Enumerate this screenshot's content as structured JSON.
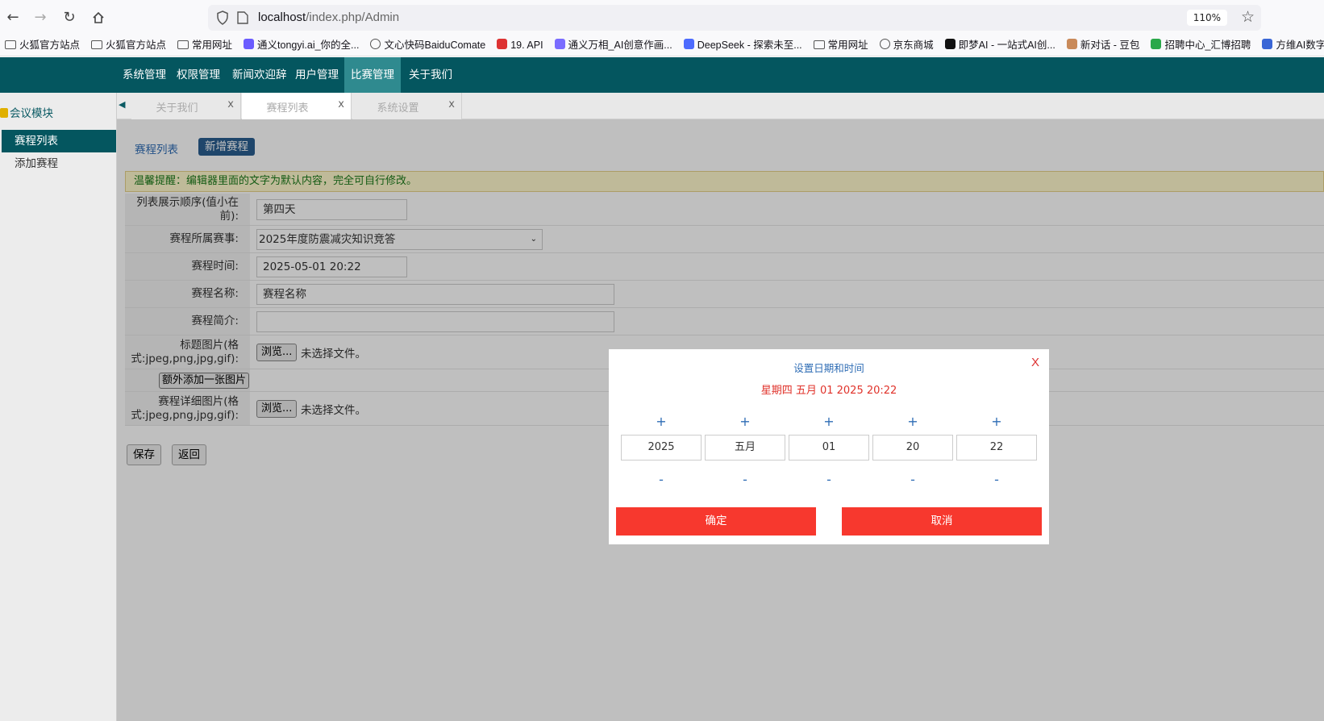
{
  "browser": {
    "url_host": "localhost",
    "url_path": "/index.php/Admin",
    "zoom": "110%",
    "bookmarks": [
      {
        "label": "火狐官方站点",
        "icon": "folder-icon"
      },
      {
        "label": "火狐官方站点",
        "icon": "folder-icon"
      },
      {
        "label": "常用网址",
        "icon": "folder-icon"
      },
      {
        "label": "通义tongyi.ai_你的全...",
        "icon": "tongyi-icon"
      },
      {
        "label": "文心快码BaiduComate",
        "icon": "globe-icon"
      },
      {
        "label": "19. API",
        "icon": "book-icon"
      },
      {
        "label": "通义万相_AI创意作画...",
        "icon": "wanxiang-icon"
      },
      {
        "label": "DeepSeek - 探索未至...",
        "icon": "deepseek-icon"
      },
      {
        "label": "常用网址",
        "icon": "folder-icon"
      },
      {
        "label": "京东商城",
        "icon": "globe-icon"
      },
      {
        "label": "即梦AI - 一站式AI创...",
        "icon": "jimeng-icon"
      },
      {
        "label": "新对话 - 豆包",
        "icon": "doubao-icon"
      },
      {
        "label": "招聘中心_汇博招聘",
        "icon": "huibo-icon"
      },
      {
        "label": "方维AI数字人",
        "icon": "fangwei-icon"
      }
    ]
  },
  "appnav": {
    "items": [
      "系统管理",
      "权限管理",
      "新闻欢迎辞",
      "用户管理",
      "比赛管理",
      "关于我们"
    ],
    "active_index": 4
  },
  "sidebar": {
    "module_title": "会议模块",
    "items": [
      "赛程列表",
      "添加赛程"
    ],
    "active_index": 0
  },
  "tabs": [
    {
      "label": "关于我们",
      "close": "x"
    },
    {
      "label": "赛程列表",
      "close": "x"
    },
    {
      "label": "系统设置",
      "close": "x"
    }
  ],
  "content": {
    "subtab_link": "赛程列表",
    "subtab_active": "新增赛程",
    "notice": "温馨提醒：编辑器里面的文字为默认内容，完全可自行修改。",
    "form": {
      "order_label": "列表展示顺序(值小在前):",
      "order_value": "第四天",
      "event_label": "赛程所属赛事:",
      "event_value": "2025年度防震减灾知识竞答",
      "time_label": "赛程时间:",
      "time_value": "2025-05-01 20:22",
      "name_label": "赛程名称:",
      "name_value": "赛程名称",
      "intro_label": "赛程简介:",
      "intro_value": "",
      "title_img_label": "标题图片(格式:jpeg,png,jpg,gif):",
      "browse_label": "浏览...",
      "no_file_text": "未选择文件。",
      "extra_img_button": "额外添加一张图片",
      "detail_img_label": "赛程详细图片(格式:jpeg,png,jpg,gif):",
      "save_label": "保存",
      "back_label": "返回"
    }
  },
  "datepicker": {
    "title": "设置日期和时间",
    "close": "X",
    "current": "星期四 五月 01 2025 20:22",
    "plus": "+",
    "minus": "-",
    "fields": [
      {
        "name": "year",
        "value": "2025"
      },
      {
        "name": "month",
        "value": "五月"
      },
      {
        "name": "day",
        "value": "01"
      },
      {
        "name": "hour",
        "value": "20"
      },
      {
        "name": "minute",
        "value": "22"
      }
    ],
    "confirm_label": "确定",
    "cancel_label": "取消"
  },
  "colors": {
    "nav_bg": "#04565f",
    "nav_active": "#2f8a8f",
    "accent_red": "#f7382e",
    "link_blue": "#2f6db5"
  }
}
